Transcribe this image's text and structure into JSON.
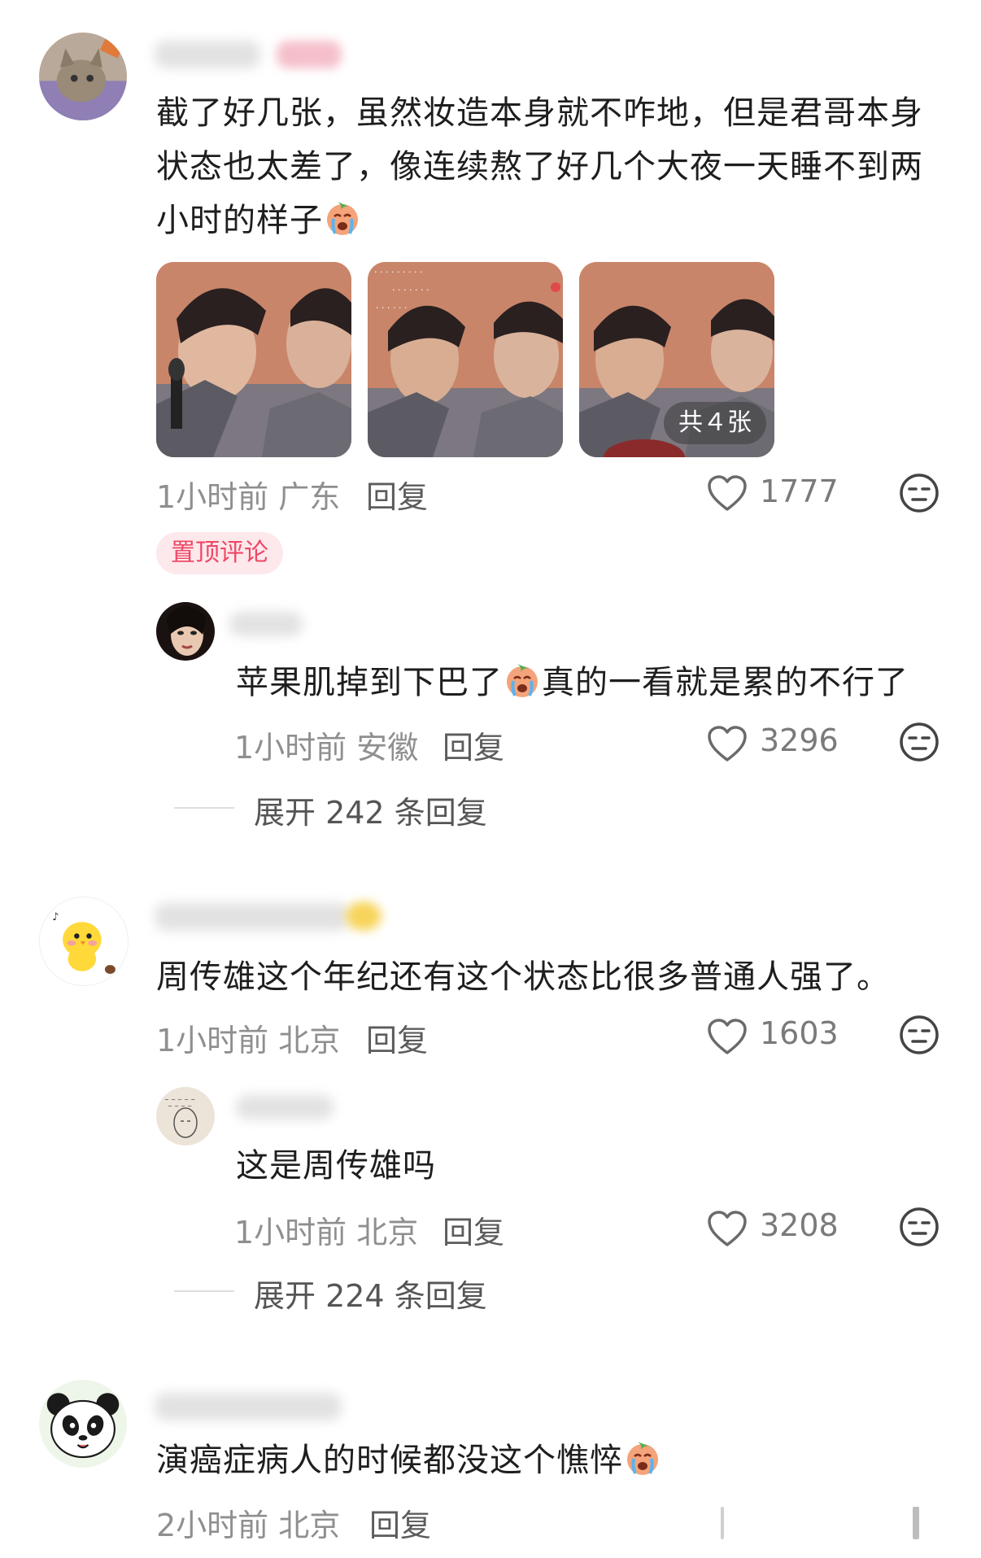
{
  "comments": [
    {
      "text_lines": [
        "截了好几张，虽然妆造本身就不咋地，但是君哥本身",
        "状态也太差了，像连续熬了好几个大夜一天睡不到两",
        "小时的样子"
      ],
      "time": "1小时前",
      "location": "广东",
      "reply_label": "回复",
      "likes": "1777",
      "pin_tag": "置顶评论",
      "images_more": "共４张",
      "sub_reply": {
        "text": "苹果肌掉到下巴了",
        "text_after": "真的一看就是累的不行了",
        "time": "1小时前",
        "location": "安徽",
        "reply_label": "回复",
        "likes": "3296"
      },
      "expand_label": "展开 242 条回复"
    },
    {
      "text_lines": [
        "周传雄这个年纪还有这个状态比很多普通人强了。"
      ],
      "time": "1小时前",
      "location": "北京",
      "reply_label": "回复",
      "likes": "1603",
      "sub_reply": {
        "text": "这是周传雄吗",
        "time": "1小时前",
        "location": "北京",
        "reply_label": "回复",
        "likes": "3208"
      },
      "expand_label": "展开 224 条回复"
    },
    {
      "text_lines": [
        "演癌症病人的时候都没这个憔悴"
      ],
      "time": "2小时前",
      "location": "北京",
      "reply_label": "回复"
    }
  ],
  "icons": {
    "like": "heart-outline-icon",
    "dislike": "neutral-face-icon",
    "emoji": "crying-face-emoji"
  },
  "colors": {
    "pin_tag_bg": "#fde8eb",
    "pin_tag_text": "#ee4866",
    "meta_text": "#8f8f8f"
  }
}
